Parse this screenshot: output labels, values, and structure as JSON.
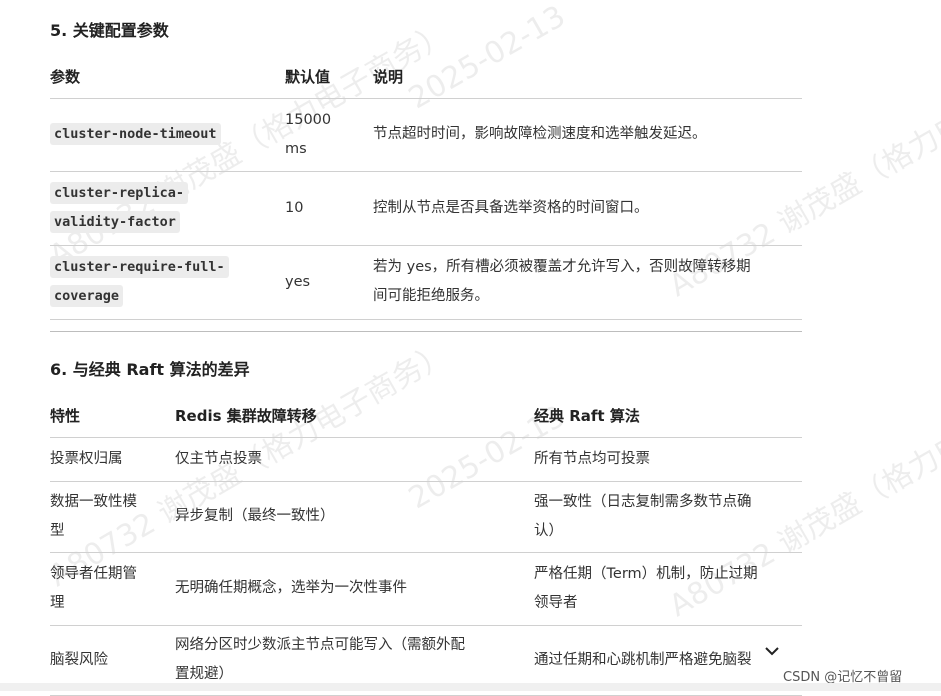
{
  "section5": {
    "title": "5. 关键配置参数",
    "headers": [
      "参数",
      "默认值",
      "说明"
    ],
    "rows": [
      {
        "param_line1": "cluster-node-timeout",
        "param_line2": "",
        "default_line1": "15000",
        "default_line2": "ms",
        "desc_line1": "节点超时时间，影响故障检测速度和选举触发延迟。",
        "desc_line2": ""
      },
      {
        "param_line1": "cluster-replica-",
        "param_line2": "validity-factor",
        "default_line1": "10",
        "default_line2": "",
        "desc_line1": "控制从节点是否具备选举资格的时间窗口。",
        "desc_line2": ""
      },
      {
        "param_line1": "cluster-require-full-",
        "param_line2": "coverage",
        "default_line1": "yes",
        "default_line2": "",
        "desc_line1": "若为 yes，所有槽必须被覆盖才允许写入，否则故障转移期",
        "desc_line2": "间可能拒绝服务。"
      }
    ]
  },
  "section6": {
    "title": "6. 与经典 Raft 算法的差异",
    "headers": [
      "特性",
      "Redis 集群故障转移",
      "经典 Raft 算法"
    ],
    "rows": [
      {
        "f1": "投票权归属",
        "f2": "",
        "r1": "仅主节点投票",
        "r2": "",
        "k1": "所有节点均可投票",
        "k2": ""
      },
      {
        "f1": "数据一致性模",
        "f2": "型",
        "r1": "异步复制（最终一致性）",
        "r2": "",
        "k1": "强一致性（日志复制需多数节点确",
        "k2": "认）"
      },
      {
        "f1": "领导者任期管",
        "f2": "理",
        "r1": "无明确任期概念，选举为一次性事件",
        "r2": "",
        "k1": "严格任期（Term）机制，防止过期",
        "k2": "领导者"
      },
      {
        "f1": "脑裂风险",
        "f2": "",
        "r1": "网络分区时少数派主节点可能写入（需额外配",
        "r2": "置规避）",
        "k1": "通过任期和心跳机制严格避免脑裂",
        "k2": ""
      }
    ]
  },
  "watermark": {
    "text_a": "A80732 谢茂盛（格力电子商务）",
    "text_b": "2025-02-13"
  },
  "credit": "CSDN @记忆不曾留"
}
